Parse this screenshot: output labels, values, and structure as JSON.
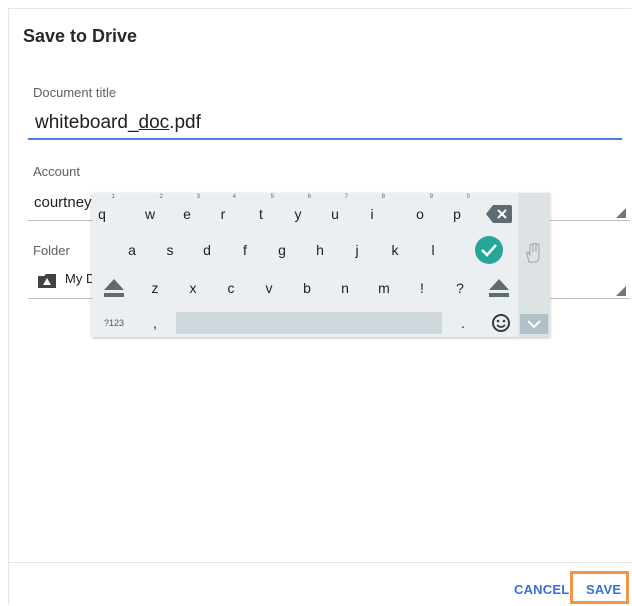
{
  "dialog": {
    "title": "Save to Drive",
    "document_title_label": "Document title",
    "document_title_prefix": "whiteboard_",
    "document_title_underlined": "doc",
    "document_title_suffix": ".pdf",
    "account_label": "Account",
    "account_value": "courtney",
    "folder_label": "Folder",
    "folder_value": "My D",
    "cancel_label": "CANCEL",
    "save_label": "SAVE"
  },
  "keyboard": {
    "row1": [
      {
        "key": "q",
        "hint": "1"
      },
      {
        "key": "w",
        "hint": "2"
      },
      {
        "key": "e",
        "hint": "3"
      },
      {
        "key": "r",
        "hint": "4"
      },
      {
        "key": "t",
        "hint": "5"
      },
      {
        "key": "y",
        "hint": "6"
      },
      {
        "key": "u",
        "hint": "7"
      },
      {
        "key": "i",
        "hint": "8"
      },
      {
        "key": "o",
        "hint": "9"
      },
      {
        "key": "p",
        "hint": "0"
      }
    ],
    "row2": [
      "a",
      "s",
      "d",
      "f",
      "g",
      "h",
      "j",
      "k",
      "l"
    ],
    "row3": [
      "z",
      "x",
      "c",
      "v",
      "b",
      "n",
      "m",
      "!",
      "?"
    ],
    "symbols_key": "?123",
    "comma_key": ",",
    "period_key": ".",
    "colors": {
      "enter": "#26a69a",
      "accent": "#4a7de8",
      "highlight": "#f0954a"
    }
  }
}
